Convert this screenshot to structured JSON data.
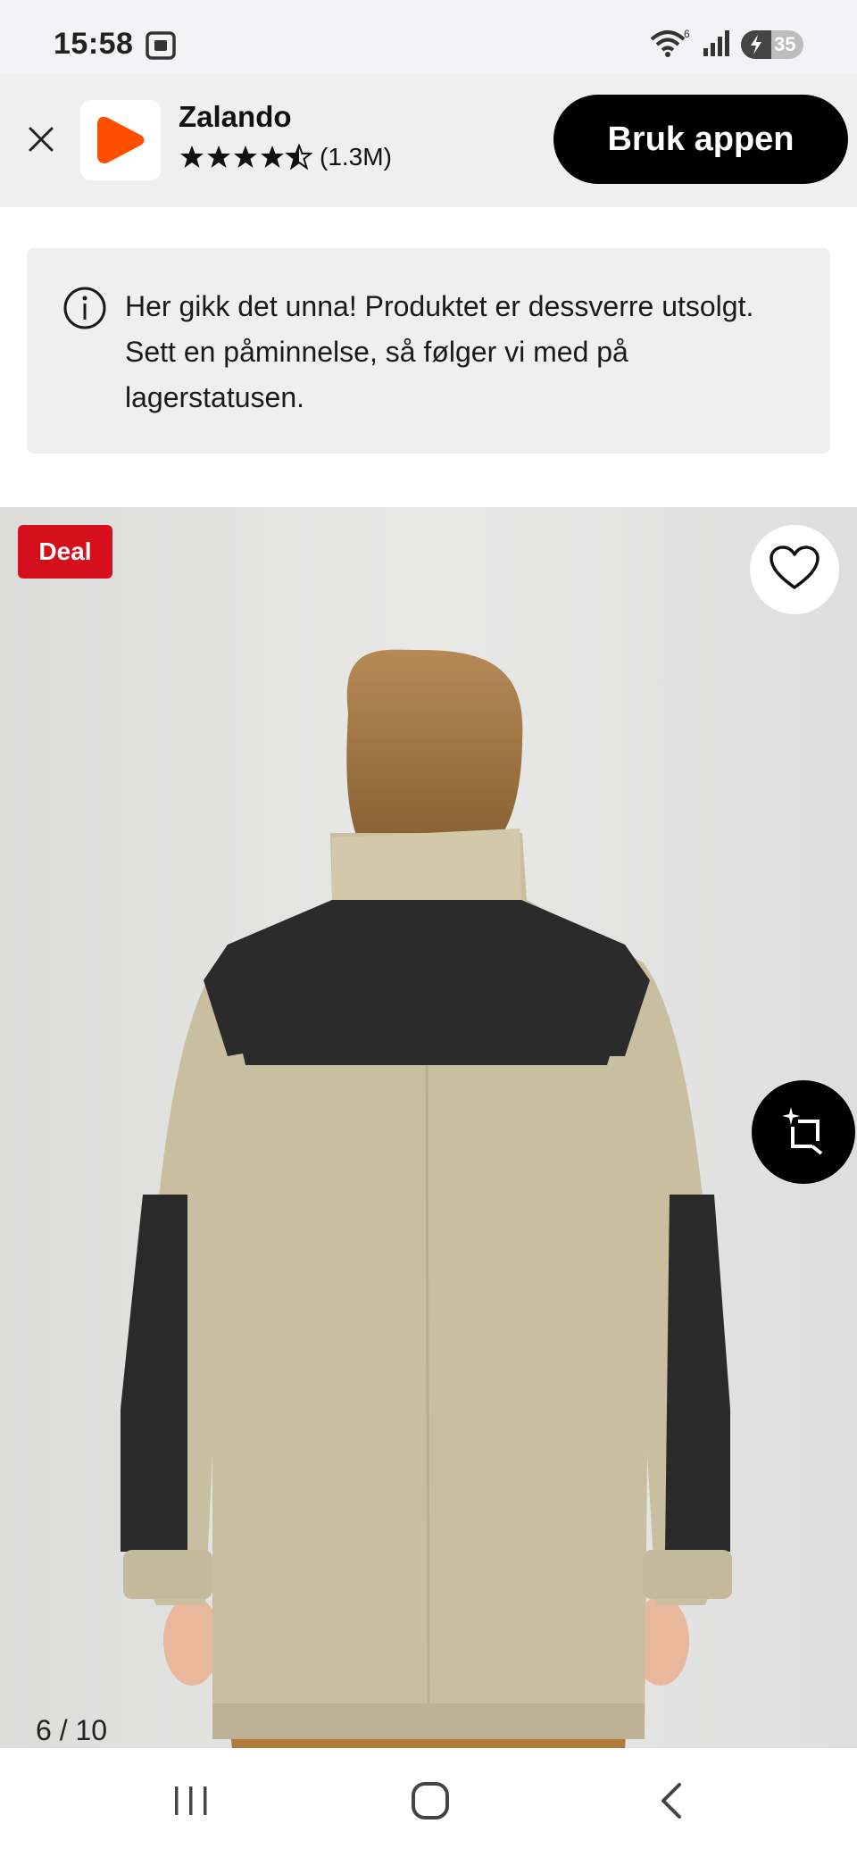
{
  "status_bar": {
    "time": "15:58",
    "battery_percent": "35",
    "wifi_badge": "6"
  },
  "app_banner": {
    "app_name": "Zalando",
    "rating_stars": 4.5,
    "rating_count": "(1.3M)",
    "open_app_label": "Bruk appen",
    "brand_color": "#ff4e00"
  },
  "notice": {
    "text": "Her gikk det unna! Produktet er dessverre utsolgt. Sett en påminnelse, så følger vi med på lagerstatusen."
  },
  "gallery": {
    "badge_label": "Deal",
    "badge_color": "#d50f1c",
    "counter": "6 / 10",
    "current_image": 6,
    "total_images": 10
  },
  "icons": {
    "close": "close-icon",
    "info": "info-icon",
    "wishlist": "heart-icon",
    "try_on": "sparkle-crop-icon"
  }
}
